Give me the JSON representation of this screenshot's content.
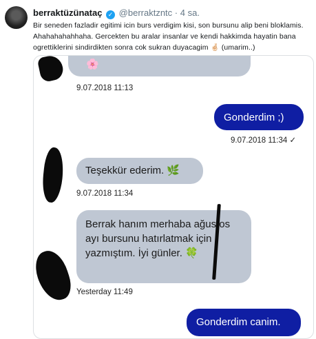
{
  "tweet": {
    "display_name": "berraktüzünataç",
    "handle": "@berraktzntc",
    "separator": "·",
    "time": "4 sa.",
    "text": "Bir seneden fazladir egitimi icin burs verdigim kisi, son bursunu alip beni bloklamis. Ahahahahahhaha. Gercekten bu aralar insanlar ve kendi hakkimda hayatin bana ogrettiklerini sindirdikten sonra cok sukran duyacagim 🤞🏻 (umarim..)"
  },
  "conversation": {
    "messages": [
      {
        "direction": "in",
        "text": "🌸"
      },
      {
        "direction": "in-time",
        "text": "9.07.2018 11:13"
      },
      {
        "direction": "out",
        "text": "Gonderdim ;)"
      },
      {
        "direction": "out-time",
        "text": "9.07.2018 11:34 ✓"
      },
      {
        "direction": "in",
        "text": "Teşekkür ederim. 🌿"
      },
      {
        "direction": "in-time",
        "text": "9.07.2018 11:34"
      },
      {
        "direction": "in",
        "text": "Berrak hanım merhaba ağustos ayı bursunu hatırlatmak için yazmıştım. İyi günler. 🍀"
      },
      {
        "direction": "in-time",
        "text": "Yesterday 11:49"
      },
      {
        "direction": "out",
        "text": "Gonderdim canim."
      }
    ]
  },
  "colors": {
    "incoming_bubble": "#bfc7d3",
    "outgoing_bubble": "#0f1ea3",
    "verified_badge": "#1da1f2"
  }
}
